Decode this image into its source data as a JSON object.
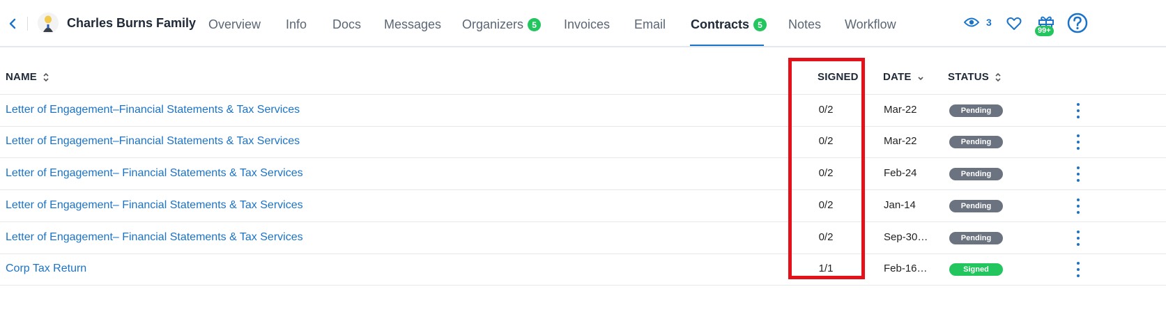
{
  "header": {
    "client_name": "Charles Burns Family",
    "tabs": [
      {
        "label": "Overview"
      },
      {
        "label": "Info"
      },
      {
        "label": "Docs"
      },
      {
        "label": "Messages"
      },
      {
        "label": "Organizers",
        "badge": "5"
      },
      {
        "label": "Invoices"
      },
      {
        "label": "Email"
      },
      {
        "label": "Contracts",
        "badge": "5",
        "active": true
      },
      {
        "label": "Notes"
      },
      {
        "label": "Workflow"
      }
    ],
    "viewers_count": "3",
    "gift_badge": "99+",
    "icons": [
      "back-chevron-icon",
      "avatar",
      "eye-icon",
      "heart-icon",
      "gift-icon",
      "help-icon"
    ],
    "accent_color": "#1a73c9",
    "badge_color": "#22c55e"
  },
  "table": {
    "columns": {
      "name": "NAME",
      "signed": "SIGNED",
      "date": "DATE",
      "status": "STATUS"
    },
    "rows": [
      {
        "name": "Letter of Engagement–Financial Statements & Tax Services",
        "signed": "0/2",
        "date": "Mar-22",
        "status": "Pending"
      },
      {
        "name": "Letter of Engagement–Financial Statements & Tax Services",
        "signed": "0/2",
        "date": "Mar-22",
        "status": "Pending"
      },
      {
        "name": "Letter of Engagement– Financial Statements & Tax Services",
        "signed": "0/2",
        "date": "Feb-24",
        "status": "Pending"
      },
      {
        "name": "Letter of Engagement– Financial Statements & Tax Services",
        "signed": "0/2",
        "date": "Jan-14",
        "status": "Pending"
      },
      {
        "name": "Letter of Engagement– Financial Statements & Tax Services",
        "signed": "0/2",
        "date": "Sep-30…",
        "status": "Pending"
      },
      {
        "name": "Corp Tax Return",
        "signed": "1/1",
        "date": "Feb-16…",
        "status": "Signed"
      }
    ],
    "status_colors": {
      "Pending": "#6b7380",
      "Signed": "#22c55e"
    },
    "highlight_color": "#e4111b"
  }
}
